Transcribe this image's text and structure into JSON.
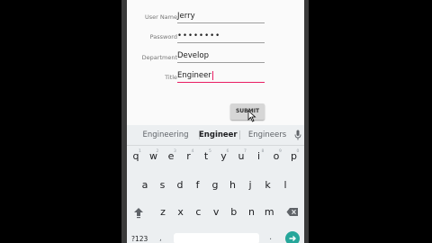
{
  "form": {
    "username": {
      "label": "User Name",
      "value": "Jerry"
    },
    "password": {
      "label": "Password",
      "value": "••••••••"
    },
    "department": {
      "label": "Department",
      "value": "Develop"
    },
    "title": {
      "label": "Title",
      "value": "Engineer"
    },
    "submit_label": "SUBMIT"
  },
  "keyboard": {
    "suggestions": [
      "Engineering",
      "Engineer",
      "Engineers"
    ],
    "row1": [
      "q",
      "w",
      "e",
      "r",
      "t",
      "y",
      "u",
      "i",
      "o",
      "p"
    ],
    "row1_hints": [
      "1",
      "2",
      "3",
      "4",
      "5",
      "6",
      "7",
      "8",
      "9",
      "0"
    ],
    "row2": [
      "a",
      "s",
      "d",
      "f",
      "g",
      "h",
      "j",
      "k",
      "l"
    ],
    "row3": [
      "z",
      "x",
      "c",
      "v",
      "b",
      "n",
      "m"
    ],
    "symbols_label": "?123",
    "accent": "#26a69a"
  },
  "colors": {
    "active_underline": "#e91e63",
    "keyboard_bg": "#eceff1"
  }
}
